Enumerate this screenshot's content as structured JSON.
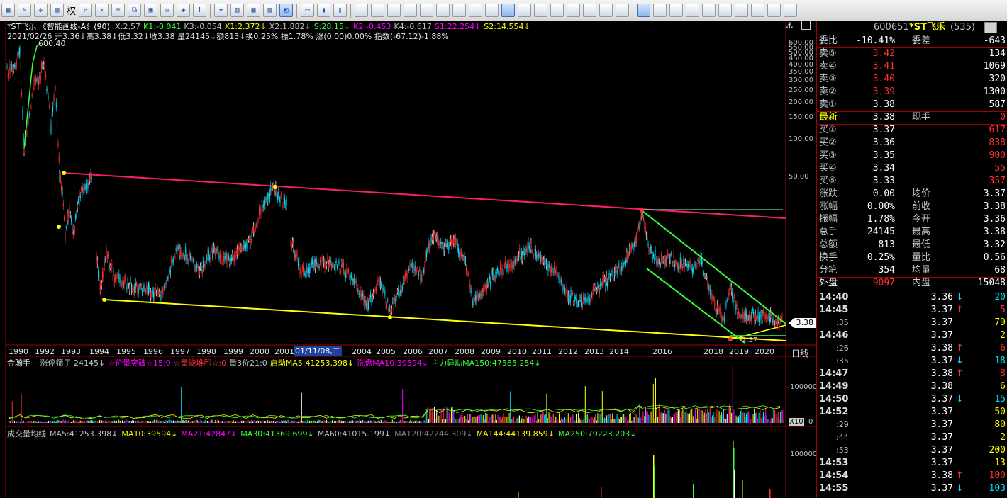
{
  "colors": {
    "up": "#ff3232",
    "down": "#00e0ff",
    "yellow": "#ffff00",
    "green": "#3cff3c",
    "magenta": "#ff00ff",
    "bg": "#000000",
    "gridred": "#a00000"
  },
  "toolbar": {
    "quanLabel": "权",
    "icons": [
      "grid-icon",
      "pencil-icon",
      "crosshair-icon",
      "panel-icon",
      "quan-icon",
      "switch-icon",
      "x-icon",
      "list-icon",
      "copy-icon",
      "note-icon",
      "mail-icon",
      "tag-icon",
      "warning-icon",
      "gear-icon",
      "table-icon",
      "table2-icon",
      "chart-icon",
      "chart-active-icon",
      "window-icon",
      "bar1-icon",
      "bar2-icon",
      "z1-icon",
      "z2-icon",
      "z3-icon",
      "z4-icon",
      "z5-icon",
      "z6-icon",
      "z7-icon",
      "z8-icon",
      "z9-icon",
      "z10-icon",
      "z11-icon",
      "z12-icon",
      "z13-icon",
      "z14-icon",
      "z15-icon",
      "z16-icon",
      "z17-icon",
      "draw-icon",
      "line-icon",
      "hline-icon",
      "vline-icon",
      "fan-icon",
      "channel-icon",
      "parallel-icon",
      "rect-icon",
      "circle-icon",
      "text-icon"
    ]
  },
  "header": {
    "title": "*ST飞乐 《智能画线-A》(90)",
    "indicators": [
      {
        "text": "X:2.57",
        "color": "#c0c0c0"
      },
      {
        "text": "K1:-0.041",
        "color": "#3cff3c"
      },
      {
        "text": "K3:-0.054",
        "color": "#c0c0c0"
      },
      {
        "text": "X1:2.372↓",
        "color": "#ffff00"
      },
      {
        "text": "X2:1.882↓",
        "color": "#c0c0c0"
      },
      {
        "text": "S:28.15↓",
        "color": "#3cff3c"
      },
      {
        "text": "K2:-0.453",
        "color": "#ff00ff"
      },
      {
        "text": "K4:-0.617",
        "color": "#c0c0c0"
      },
      {
        "text": "S1:22.254↓",
        "color": "#ff00ff"
      },
      {
        "text": "S2:14.554↓",
        "color": "#ffff00"
      }
    ],
    "dayline": "2021/02/26 开3.36↓高3.38↓低3.32↓收3.38 量24145↓额813↓换0.25% 振1.78% 涨(0.00)0.00% 指数(-67.12)-1.88%",
    "peakLabel": "600.40",
    "priceTag": "3.38",
    "lowLabel": "2.37"
  },
  "priceAxis": [
    {
      "v": 600,
      "label": "600.00"
    },
    {
      "v": 550,
      "label": "550.00"
    },
    {
      "v": 500,
      "label": "500.00"
    },
    {
      "v": 450,
      "label": "450.00"
    },
    {
      "v": 400,
      "label": "400.00"
    },
    {
      "v": 350,
      "label": "350.00"
    },
    {
      "v": 300,
      "label": "300.00"
    },
    {
      "v": 250,
      "label": "250.00"
    },
    {
      "v": 200,
      "label": "200.00"
    },
    {
      "v": 150,
      "label": "150.00"
    },
    {
      "v": 100,
      "label": "100.00"
    },
    {
      "v": 50,
      "label": "50.00"
    }
  ],
  "timeAxis": {
    "labels": [
      "1990",
      "1992",
      "1993",
      "1994",
      "1995",
      "1996",
      "1997",
      "1998",
      "1999",
      "2000",
      "2001",
      "2004",
      "2005",
      "2006",
      "2007",
      "2008",
      "2009",
      "2010",
      "2011",
      "2012",
      "2013",
      "2014",
      "2016",
      "2018",
      "2019",
      "2020"
    ],
    "cursor": "01/11/08,二",
    "period": "日线"
  },
  "volPanel": {
    "title": "金骑手",
    "items": [
      {
        "text": "涨停筛子 24145↓",
        "color": "#c0c0c0"
      },
      {
        "text": "☆价量突破☆15:0",
        "color": "#ff00ff"
      },
      {
        "text": "☆量能堆积☆:0",
        "color": "#ff3232"
      },
      {
        "text": "量3价21:0",
        "color": "#c0c0c0"
      },
      {
        "text": "启动MA5:41253.398↓",
        "color": "#ffff00"
      },
      {
        "text": "洗盘MA10:39594↓",
        "color": "#ff00ff"
      },
      {
        "text": "主力异动MA150:47585.254↓",
        "color": "#3cff3c"
      }
    ],
    "axis": [
      "100000",
      "0"
    ],
    "scale": "X10"
  },
  "maPanel": {
    "items": [
      {
        "text": "成交量均线",
        "color": "#c0c0c0"
      },
      {
        "text": "MA5:41253.398↓",
        "color": "#c0c0c0"
      },
      {
        "text": "MA10:39594↓",
        "color": "#ffff00"
      },
      {
        "text": "MA21:42847↓",
        "color": "#ff00ff"
      },
      {
        "text": "MA30:41369.699↓",
        "color": "#3cff3c"
      },
      {
        "text": "MA60:41015.199↓",
        "color": "#c0c0c0"
      },
      {
        "text": "MA120:42244.309↓",
        "color": "#808080"
      },
      {
        "text": "MA144:44139.859↓",
        "color": "#ffff00"
      },
      {
        "text": "MA250:79223.203↓",
        "color": "#3cff3c"
      }
    ],
    "axis": [
      "100000"
    ]
  },
  "stock": {
    "code": "600651",
    "name": "*ST飞乐",
    "id": "(535)"
  },
  "quote": {
    "weibi": {
      "label": "委比",
      "value": "-10.41%",
      "label2": "委差",
      "value2": "-643"
    },
    "sells": [
      {
        "label": "卖⑤",
        "price": "3.42",
        "vol": "134"
      },
      {
        "label": "卖④",
        "price": "3.41",
        "vol": "1069"
      },
      {
        "label": "卖③",
        "price": "3.40",
        "vol": "320"
      },
      {
        "label": "卖②",
        "price": "3.39",
        "vol": "1300"
      },
      {
        "label": "卖①",
        "price": "3.38",
        "vol": "587"
      }
    ],
    "latest": {
      "label": "最新",
      "price": "3.38",
      "label2": "现手",
      "vol": "0"
    },
    "buys": [
      {
        "label": "买①",
        "price": "3.37",
        "vol": "617"
      },
      {
        "label": "买②",
        "price": "3.36",
        "vol": "838"
      },
      {
        "label": "买③",
        "price": "3.35",
        "vol": "900"
      },
      {
        "label": "买④",
        "price": "3.34",
        "vol": "55"
      },
      {
        "label": "买⑤",
        "price": "3.33",
        "vol": "357"
      }
    ],
    "stats": [
      {
        "l": "涨跌",
        "v": "0.00",
        "l2": "均价",
        "v2": "3.37"
      },
      {
        "l": "涨幅",
        "v": "0.00%",
        "l2": "前收",
        "v2": "3.38"
      },
      {
        "l": "振幅",
        "v": "1.78%",
        "l2": "今开",
        "v2": "3.36"
      },
      {
        "l": "总手",
        "v": "24145",
        "l2": "最高",
        "v2": "3.38"
      },
      {
        "l": "总额",
        "v": "813",
        "l2": "最低",
        "v2": "3.32"
      },
      {
        "l": "换手",
        "v": "0.25%",
        "l2": "量比",
        "v2": "0.56"
      },
      {
        "l": "分笔",
        "v": "354",
        "l2": "均量",
        "v2": "68"
      }
    ],
    "outer": {
      "label": "外盘",
      "value": "9097",
      "label2": "内盘",
      "value2": "15048"
    }
  },
  "ticks": [
    {
      "t": "14:40",
      "p": "3.36",
      "d": "down",
      "v": "20"
    },
    {
      "t": "14:45",
      "p": "3.37",
      "d": "up",
      "v": "5"
    },
    {
      "t": ":35",
      "p": "3.37",
      "d": "",
      "v": "79"
    },
    {
      "t": "14:46",
      "p": "3.37",
      "d": "",
      "v": "2"
    },
    {
      "t": ":26",
      "p": "3.38",
      "d": "up",
      "v": "6"
    },
    {
      "t": ":35",
      "p": "3.37",
      "d": "down",
      "v": "18"
    },
    {
      "t": "14:47",
      "p": "3.38",
      "d": "up",
      "v": "8"
    },
    {
      "t": "14:49",
      "p": "3.38",
      "d": "",
      "v": "6"
    },
    {
      "t": "14:50",
      "p": "3.37",
      "d": "down",
      "v": "15"
    },
    {
      "t": "14:52",
      "p": "3.37",
      "d": "",
      "v": "50"
    },
    {
      "t": ":29",
      "p": "3.37",
      "d": "",
      "v": "80"
    },
    {
      "t": ":44",
      "p": "3.37",
      "d": "",
      "v": "2"
    },
    {
      "t": ":53",
      "p": "3.37",
      "d": "",
      "v": "200"
    },
    {
      "t": "14:53",
      "p": "3.37",
      "d": "",
      "v": "13"
    },
    {
      "t": "14:54",
      "p": "3.38",
      "d": "up",
      "v": "100"
    },
    {
      "t": "14:55",
      "p": "3.37",
      "d": "down",
      "v": "103"
    }
  ]
}
